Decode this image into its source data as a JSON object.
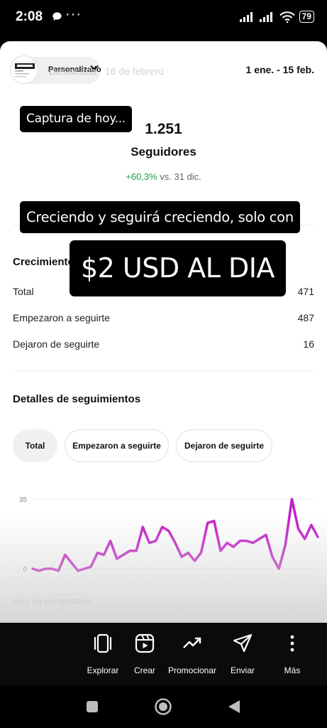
{
  "status_bar": {
    "time": "2:08",
    "dots": "···",
    "battery": "79"
  },
  "story": {
    "progress": 0.66
  },
  "header": {
    "pill_label": "Personalizado",
    "faded_title": "Destacada",
    "faded_date": "16 de febrero",
    "date_range": "1 ene. - 15 feb."
  },
  "summary": {
    "followers": "1.251",
    "followers_label": "Seguidores",
    "growth_pct": "+60,3%",
    "growth_vs": "vs. 31 dic."
  },
  "overlays": {
    "caption1": "Captura de hoy...",
    "caption2": "Creciendo y seguirá creciendo, solo con",
    "caption3": "$2 USD AL DIA"
  },
  "growth_section": {
    "title": "Crecimiento",
    "rows": [
      {
        "label": "Total",
        "value": "471"
      },
      {
        "label": "Empezaron a seguirte",
        "value": "487"
      },
      {
        "label": "Dejaron de seguirte",
        "value": "16"
      }
    ]
  },
  "details": {
    "title": "Detalles de seguimientos",
    "tabs": [
      "Total",
      "Empezaron a seguirte",
      "Dejaron de seguirte"
    ],
    "active_tab": "Total"
  },
  "chart_data": {
    "type": "line",
    "y_ticks": [
      "35",
      "0"
    ],
    "ylim": [
      0,
      35
    ],
    "color": "#c41ec8",
    "series": [
      {
        "values": [
          0,
          -1,
          0,
          0,
          -1,
          7,
          3,
          -1,
          0,
          1,
          8,
          7,
          14,
          5,
          7,
          9,
          9,
          21,
          13,
          14,
          21,
          19,
          13,
          6,
          8,
          4,
          8,
          23,
          24,
          9,
          13,
          11,
          14,
          14,
          13,
          15,
          17,
          6,
          0,
          12,
          35,
          20,
          15,
          22,
          16
        ]
      }
    ]
  },
  "comment_placeholder": "Haz un comentario...",
  "actions": [
    {
      "label": "Explorar",
      "icon": "explore-icon"
    },
    {
      "label": "Crear",
      "icon": "create-icon"
    },
    {
      "label": "Promocionar",
      "icon": "trend-icon"
    },
    {
      "label": "Enviar",
      "icon": "send-icon"
    },
    {
      "label": "Más",
      "icon": "more-icon"
    }
  ]
}
